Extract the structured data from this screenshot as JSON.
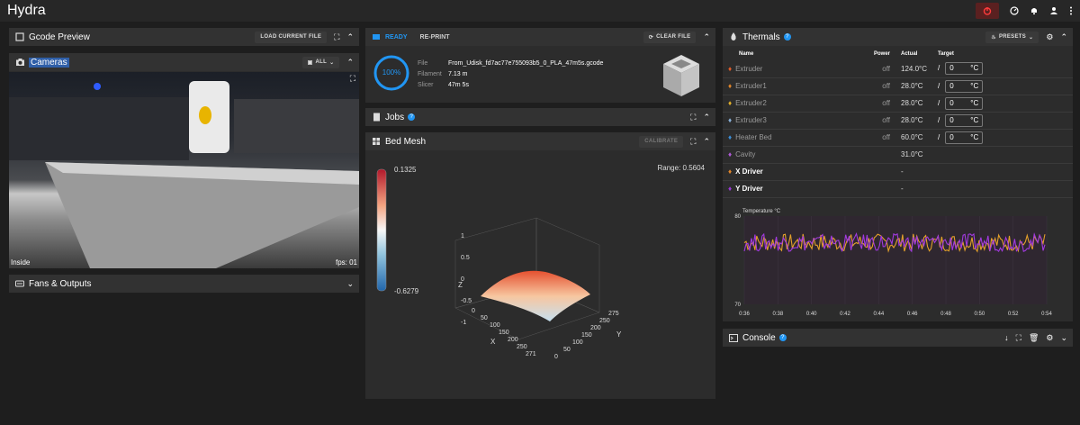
{
  "app": {
    "title": "Hydra"
  },
  "gcode": {
    "title": "Gcode Preview",
    "load_btn": "LOAD CURRENT FILE"
  },
  "cameras": {
    "title": "Cameras",
    "all_btn": "ALL",
    "cam_name": "Inside",
    "fps": "fps: 01"
  },
  "fans": {
    "title": "Fans & Outputs"
  },
  "status": {
    "state": "READY",
    "reprint": "RE-PRINT",
    "clear": "CLEAR FILE",
    "progress_label": "100%",
    "progress": 1.0,
    "rows": [
      {
        "k": "File",
        "v": "From_Udisk_fd7ac77e755093b5_0_PLA_47m5s.gcode"
      },
      {
        "k": "Filament",
        "v": "7.13 m"
      },
      {
        "k": "Slicer",
        "v": "47m 5s"
      }
    ]
  },
  "jobs": {
    "title": "Jobs"
  },
  "mesh": {
    "title": "Bed Mesh",
    "calibrate": "CALIBRATE",
    "range": "Range: 0.5604",
    "scale_max": "0.1325",
    "scale_min": "-0.6279",
    "z_ticks": [
      "1",
      "0.5",
      "0",
      "-0.5",
      "-1"
    ],
    "z_label": "Z",
    "x_label": "X",
    "y_label": "Y",
    "x_ticks": [
      "0",
      "50",
      "100",
      "150",
      "200",
      "250",
      "271"
    ],
    "y_ticks": [
      "0",
      "50",
      "100",
      "150",
      "200",
      "250",
      "275"
    ]
  },
  "thermals": {
    "title": "Thermals",
    "presets": "PRESETS",
    "cols": [
      "Name",
      "Power",
      "Actual",
      "Target"
    ],
    "rows": [
      {
        "name": "Extruder",
        "power": "off",
        "actual": "124.0°C",
        "target": "0",
        "unit": "°C",
        "color": "#e35d2a"
      },
      {
        "name": "Extruder1",
        "power": "off",
        "actual": "28.0°C",
        "target": "0",
        "unit": "°C",
        "color": "#e3862a"
      },
      {
        "name": "Extruder2",
        "power": "off",
        "actual": "28.0°C",
        "target": "0",
        "unit": "°C",
        "color": "#e3b12a"
      },
      {
        "name": "Extruder3",
        "power": "off",
        "actual": "28.0°C",
        "target": "0",
        "unit": "°C",
        "color": "#8ab0d8"
      },
      {
        "name": "Heater Bed",
        "power": "off",
        "actual": "60.0°C",
        "target": "0",
        "unit": "°C",
        "color": "#3b8ed8"
      },
      {
        "name": "Cavity",
        "power": "",
        "actual": "31.0°C",
        "target": "",
        "unit": "",
        "color": "#b05ad8"
      },
      {
        "name": "X Driver",
        "power": "",
        "actual": "-",
        "target": "",
        "unit": "",
        "color": "#e3862a"
      },
      {
        "name": "Y Driver",
        "power": "",
        "actual": "-",
        "target": "",
        "unit": "",
        "color": "#9b3ad8"
      }
    ],
    "slash": "/"
  },
  "chart_data": {
    "type": "line",
    "ylabel": "Temperature °C",
    "ylim": [
      70,
      80
    ],
    "y_ticks": [
      "80",
      "70"
    ],
    "x": [
      "0:36",
      "0:38",
      "0:40",
      "0:42",
      "0:44",
      "0:46",
      "0:48",
      "0:50",
      "0:52",
      "0:54"
    ],
    "series": [
      {
        "name": "X Driver",
        "color": "#e3a02a"
      },
      {
        "name": "Y Driver",
        "color": "#a23ae0"
      }
    ],
    "note_value_band": [
      76,
      78
    ]
  },
  "console": {
    "title": "Console"
  }
}
